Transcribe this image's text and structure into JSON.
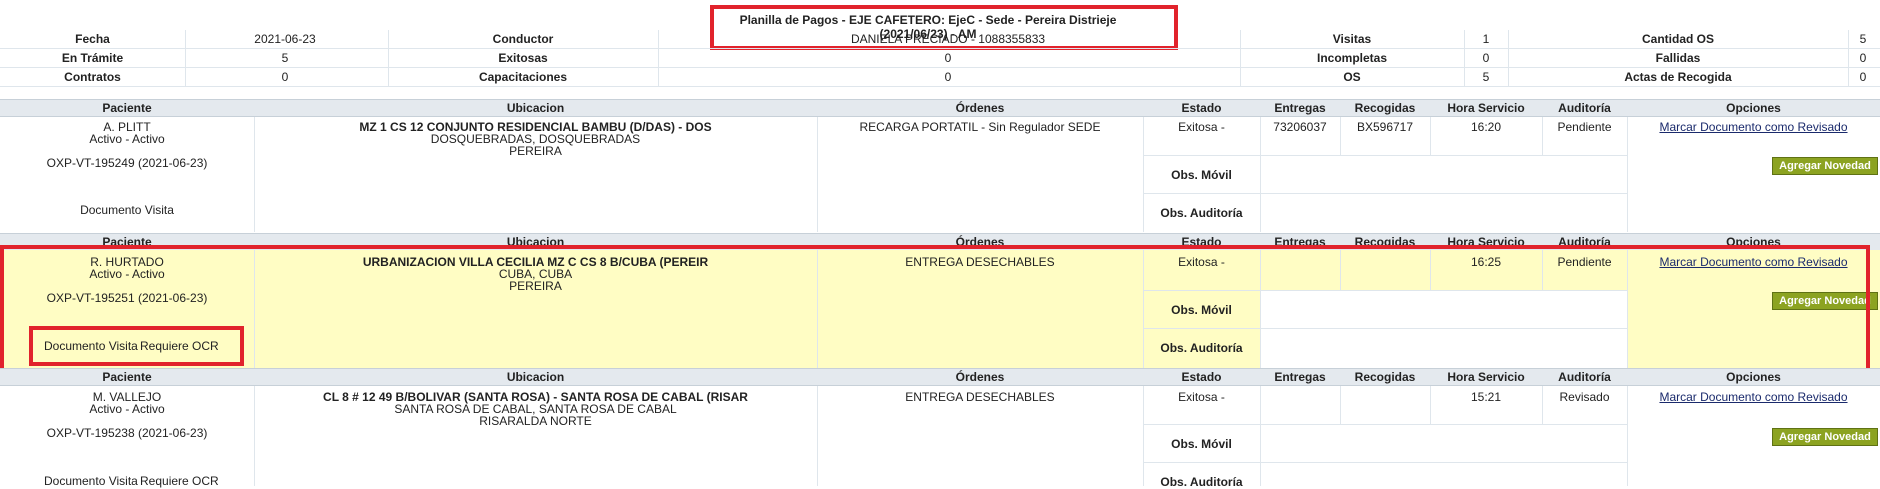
{
  "title": "Planilla de Pagos - EJE CAFETERO: EjeC - Sede - Pereira Distrieje (2021/06/23) - AM",
  "summary": {
    "row1": {
      "fecha_label": "Fecha",
      "fecha": "2021-06-23",
      "conductor_label": "Conductor",
      "conductor": "DANIELA PRECIADO - 1088355833",
      "visitas_label": "Visitas",
      "visitas": "1",
      "cantidad_os_label": "Cantidad OS",
      "cantidad_os": "5"
    },
    "row2": {
      "en_tramite_label": "En Trámite",
      "en_tramite": "5",
      "exitosas_label": "Exitosas",
      "exitosas": "0",
      "incompletas_label": "Incompletas",
      "incompletas": "0",
      "fallidas_label": "Fallidas",
      "fallidas": "0"
    },
    "row3": {
      "contratos_label": "Contratos",
      "contratos": "0",
      "capacitaciones_label": "Capacitaciones",
      "capacitaciones": "0",
      "os_label": "OS",
      "os": "5",
      "actas_label": "Actas de Recogida",
      "actas": "0"
    }
  },
  "columns": {
    "paciente": "Paciente",
    "ubicacion": "Ubicacion",
    "ordenes": "Órdenes",
    "estado": "Estado",
    "entregas": "Entregas",
    "recogidas": "Recogidas",
    "hora": "Hora Servicio",
    "auditoria": "Auditoría",
    "opciones": "Opciones"
  },
  "labels": {
    "obs_movil": "Obs. Móvil",
    "obs_auditoria": "Obs. Auditoría",
    "marcar": "Marcar Documento como Revisado",
    "agregar": "Agregar Novedad",
    "doc_visita": "Documento Visita",
    "requiere_ocr": "Requiere OCR"
  },
  "records": [
    {
      "paciente": "A. PLITT",
      "estado_pac": "Activo - Activo",
      "orden_id": "OXP-VT-195249 (2021-06-23)",
      "direccion": "MZ 1 CS 12 CONJUNTO RESIDENCIAL BAMBU (D/DAS) - DOS",
      "ciudad": "DOSQUEBRADAS, DOSQUEBRADAS",
      "depto": "PEREIRA",
      "ordenes": "RECARGA PORTATIL - Sin Regulador SEDE",
      "estado": "Exitosa -",
      "entregas": "73206037",
      "recogidas": "BX596717",
      "hora": "16:20",
      "auditoria": "Pendiente",
      "requiere_ocr": ""
    },
    {
      "paciente": "R. HURTADO",
      "estado_pac": "Activo - Activo",
      "orden_id": "OXP-VT-195251 (2021-06-23)",
      "direccion": "URBANIZACION VILLA CECILIA MZ C CS 8 B/CUBA (PEREIR",
      "ciudad": "CUBA, CUBA",
      "depto": "PEREIRA",
      "ordenes": "ENTREGA DESECHABLES",
      "estado": "Exitosa -",
      "entregas": "",
      "recogidas": "",
      "hora": "16:25",
      "auditoria": "Pendiente",
      "requiere_ocr": "Requiere OCR"
    },
    {
      "paciente": "M. VALLEJO",
      "estado_pac": "Activo - Activo",
      "orden_id": "OXP-VT-195238 (2021-06-23)",
      "direccion": "CL 8 # 12 49 B/BOLIVAR (SANTA ROSA) - SANTA ROSA DE CABAL (RISAR",
      "ciudad": "SANTA ROSA DE CABAL, SANTA ROSA DE CABAL",
      "depto": "RISARALDA NORTE",
      "ordenes": "ENTREGA DESECHABLES",
      "estado": "Exitosa -",
      "entregas": "",
      "recogidas": "",
      "hora": "15:21",
      "auditoria": "Revisado",
      "requiere_ocr": "Requiere OCR"
    }
  ],
  "colors": {
    "highlight_box": "#e1232c",
    "row_highlight": "#fffdc4",
    "button": "#8ca321",
    "header_bg": "#e4e9ee"
  }
}
